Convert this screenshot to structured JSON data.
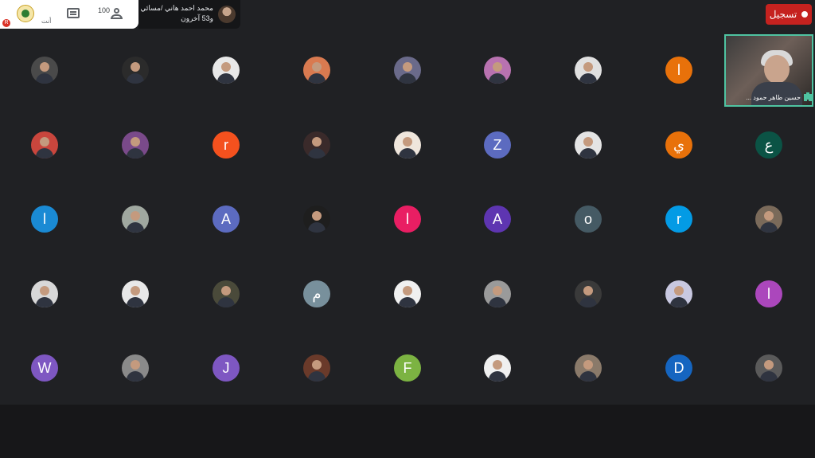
{
  "topbar": {
    "self_label": "أنت",
    "rec_indicator": "R",
    "participant_count": "100",
    "presenter_name": "محمد احمد هاني /مسائي",
    "presenter_others": "و53 آخرون",
    "record_button_label": "تسجيل"
  },
  "self_video": {
    "caption": "حسين طاهر حمود ...",
    "border_color": "#4fc3a1"
  },
  "tiles": [
    {
      "initial": "",
      "color": "#4a4a4a",
      "kind": "photo"
    },
    {
      "initial": "",
      "color": "#2b2b2b",
      "kind": "photo"
    },
    {
      "initial": "",
      "color": "#e8e8e8",
      "kind": "photo"
    },
    {
      "initial": "",
      "color": "#d97a50",
      "kind": "photo"
    },
    {
      "initial": "",
      "color": "#6a6a8a",
      "kind": "photo"
    },
    {
      "initial": "",
      "color": "#b872b0",
      "kind": "photo"
    },
    {
      "initial": "",
      "color": "#e0e0e0",
      "kind": "photo"
    },
    {
      "initial": "ا",
      "color": "#e8710a",
      "kind": "letter"
    },
    {
      "initial": "",
      "color": "#c9463d",
      "kind": "photo"
    },
    {
      "initial": "",
      "color": "#7a4a8a",
      "kind": "photo"
    },
    {
      "initial": "r",
      "color": "#f4511e",
      "kind": "letter"
    },
    {
      "initial": "",
      "color": "#3a2a2a",
      "kind": "photo"
    },
    {
      "initial": "",
      "color": "#efe6dc",
      "kind": "photo"
    },
    {
      "initial": "Z",
      "color": "#5c6bc0",
      "kind": "letter"
    },
    {
      "initial": "",
      "color": "#e4e4e4",
      "kind": "photo"
    },
    {
      "initial": "ي",
      "color": "#e8710a",
      "kind": "letter"
    },
    {
      "initial": "ع",
      "color": "#0b5345",
      "kind": "letter"
    },
    {
      "initial": "ا",
      "color": "#1a8ad4",
      "kind": "letter"
    },
    {
      "initial": "",
      "color": "#a0a8a0",
      "kind": "photo"
    },
    {
      "initial": "A",
      "color": "#5c6bc0",
      "kind": "letter"
    },
    {
      "initial": "",
      "color": "#1e1e1e",
      "kind": "photo"
    },
    {
      "initial": "ا",
      "color": "#e91e63",
      "kind": "letter"
    },
    {
      "initial": "A",
      "color": "#5e35b1",
      "kind": "letter"
    },
    {
      "initial": "o",
      "color": "#455a64",
      "kind": "letter"
    },
    {
      "initial": "r",
      "color": "#039be5",
      "kind": "letter"
    },
    {
      "initial": "",
      "color": "#7a6a5a",
      "kind": "photo"
    },
    {
      "initial": "",
      "color": "#d8d8d8",
      "kind": "photo"
    },
    {
      "initial": "",
      "color": "#e8e8e8",
      "kind": "photo"
    },
    {
      "initial": "",
      "color": "#4a4a3a",
      "kind": "photo"
    },
    {
      "initial": "م",
      "color": "#78909c",
      "kind": "letter"
    },
    {
      "initial": "",
      "color": "#f0f0f0",
      "kind": "photo"
    },
    {
      "initial": "",
      "color": "#9a9a9a",
      "kind": "photo"
    },
    {
      "initial": "",
      "color": "#3a3a3a",
      "kind": "photo"
    },
    {
      "initial": "",
      "color": "#c8c8e0",
      "kind": "photo"
    },
    {
      "initial": "ا",
      "color": "#ab47bc",
      "kind": "letter"
    },
    {
      "initial": "W",
      "color": "#7e57c2",
      "kind": "letter"
    },
    {
      "initial": "",
      "color": "#8a8a8a",
      "kind": "photo"
    },
    {
      "initial": "J",
      "color": "#7e57c2",
      "kind": "letter"
    },
    {
      "initial": "",
      "color": "#6a3a2a",
      "kind": "photo"
    },
    {
      "initial": "F",
      "color": "#7cb342",
      "kind": "letter"
    },
    {
      "initial": "",
      "color": "#f0f0f0",
      "kind": "photo"
    },
    {
      "initial": "",
      "color": "#8a7a6a",
      "kind": "photo"
    },
    {
      "initial": "D",
      "color": "#1565c0",
      "kind": "letter"
    },
    {
      "initial": "",
      "color": "#5a5a5a",
      "kind": "photo"
    }
  ]
}
